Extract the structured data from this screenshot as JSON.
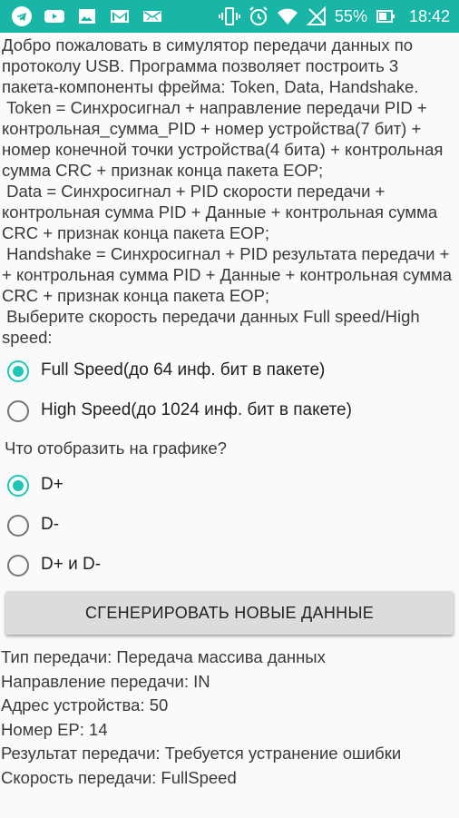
{
  "status": {
    "battery": "55%",
    "time": "18:42",
    "icons_left": [
      "telegram-icon",
      "youtube-icon",
      "gallery-icon",
      "gmail-icon",
      "message-icon"
    ],
    "icons_right": [
      "vibrate-icon",
      "alarm-icon",
      "wifi-icon",
      "no-signal-icon",
      "battery-icon"
    ],
    "accent": "#19b6a7"
  },
  "intro": "Добро пожаловать в симулятор передачи данных по протоколу USB. Программа позволяет построить 3 пакета-компоненты фрейма: Token, Data, Handshake.\n Token = Синхросигнал + направление передачи PID + контрольная_сумма_PID + номер устройства(7 бит) + номер конечной точки устройства(4 бита) + контрольная сумма CRC + признак конца пакета EOP;\n Data = Синхросигнал + PID скорости передачи + контрольная сумма PID + Данные + контрольная сумма CRC + признак конца пакета EOP;\n Handshake = Синхросигнал + PID результата передачи + + контрольная сумма PID + Данные + контрольная сумма CRC + признак конца пакета EOP;\n Выберите скорость передачи данных Full speed/High speed:",
  "speed_options": [
    {
      "label": "Full Speed(до 64 инф. бит в пакете)",
      "checked": true
    },
    {
      "label": "High Speed(до 1024 инф. бит в пакете)",
      "checked": false
    }
  ],
  "graph_question": "Что отобразить на графике?",
  "graph_options": [
    {
      "label": "D+",
      "checked": true
    },
    {
      "label": "D-",
      "checked": false
    },
    {
      "label": "D+ и D-",
      "checked": false
    }
  ],
  "generate_button": "СГЕНЕРИРОВАТЬ НОВЫЕ ДАННЫЕ",
  "results": [
    "Тип передачи: Передача массива данных",
    "Направление передачи: IN",
    "Адрес устройства: 50",
    "Номер EP: 14",
    "Результат передачи: Требуется устранение ошибки",
    "Скорость передачи: FullSpeed"
  ]
}
